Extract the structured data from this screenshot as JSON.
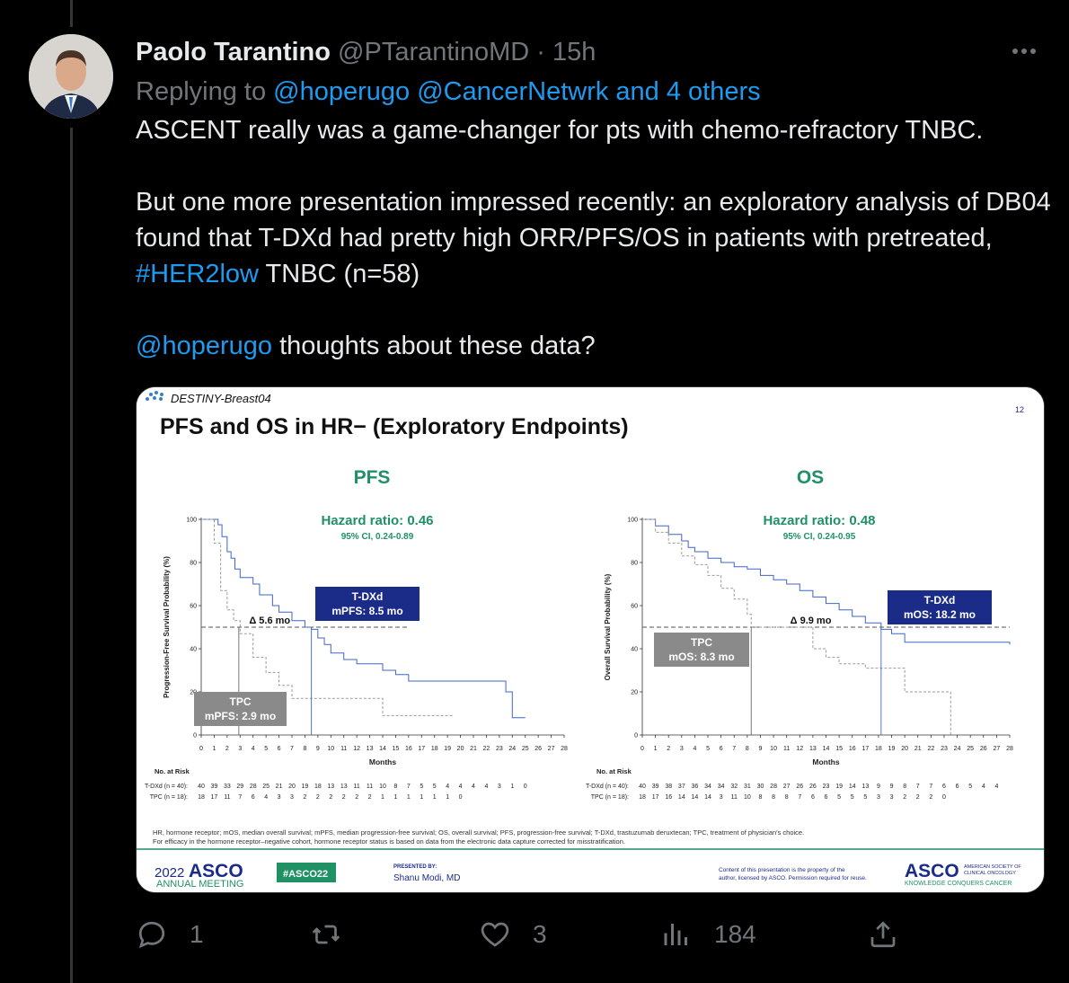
{
  "tweet": {
    "author_name": "Paolo Tarantino",
    "handle": "@PTarantinoMD",
    "separator": "·",
    "time": "15h",
    "replying_prefix": "Replying to",
    "replying_to": "@hoperugo @CancerNetwrk and 4 others",
    "paragraph1": "ASCENT really was a game-changer for pts with chemo-refractory TNBC.",
    "paragraph2_pre": "But one more presentation impressed recently: an exploratory analysis of DB04 found that T-DXd had pretty high ORR/PFS/OS in patients with pretreated,",
    "paragraph2_hashtag": "#HER2low",
    "paragraph2_post": "TNBC (n=58)",
    "paragraph3_mention": "@hoperugo",
    "paragraph3_post": "thoughts about these data?"
  },
  "actions": {
    "replies": "1",
    "retweets": "",
    "likes": "3",
    "views": "184"
  },
  "slide": {
    "study": "DESTINY-Breast04",
    "page": "12",
    "title": "PFS and OS in HR− (Exploratory Endpoints)",
    "footnote1": "HR, hormone receptor; mOS, median overall survival; mPFS, median progression-free survival; OS, overall survival; PFS, progression-free survival; T-DXd, trastuzumab deruxtecan; TPC, treatment of physician's choice.",
    "footnote2": "For efficacy in the hormone receptor–negative cohort, hormone receptor status is based on data from the electronic data capture corrected for misstratification.",
    "footer": {
      "meeting_year": "2022",
      "meeting_name": "ASCO",
      "meeting_sub": "ANNUAL MEETING",
      "hashtag": "#ASCO22",
      "presented_by": "PRESENTED BY:",
      "presenter": "Shanu Modi, MD",
      "copyright1": "Content of this presentation is the property of the",
      "copyright2": "author, licensed by ASCO. Permission required for reuse.",
      "asco": "ASCO",
      "asco_sub1": "AMERICAN SOCIETY OF",
      "asco_sub2": "CLINICAL ONCOLOGY",
      "tagline": "KNOWLEDGE CONQUERS CANCER"
    }
  },
  "colors": {
    "green": "#1f9165",
    "navy": "#1b2b88",
    "tdxd_line": "#3f66c6",
    "tpc_line": "#9a9a9a",
    "tpc_box": "#8a8a8a"
  },
  "chart_data": [
    {
      "type": "line",
      "title": "PFS",
      "hr_text": "Hazard ratio: 0.46",
      "ci_text": "95% CI, 0.24-0.89",
      "xlabel": "Months",
      "ylabel": "Progression-Free Survival Probability (%)",
      "xlim": [
        0,
        28
      ],
      "ylim": [
        0,
        100
      ],
      "xticks": [
        0,
        1,
        2,
        3,
        4,
        5,
        6,
        7,
        8,
        9,
        10,
        11,
        12,
        13,
        14,
        15,
        16,
        17,
        18,
        19,
        20,
        21,
        22,
        23,
        24,
        25,
        26,
        27,
        28
      ],
      "yticks": [
        0,
        20,
        40,
        60,
        80,
        100
      ],
      "delta_label": "Δ 5.6 mo",
      "tdxd_box": [
        "T-DXd",
        "mPFS: 8.5 mo"
      ],
      "tpc_box": [
        "TPC",
        "mPFS: 2.9 mo"
      ],
      "series": [
        {
          "name": "T-DXd",
          "x": [
            0,
            1,
            1.3,
            1.6,
            2,
            2.3,
            2.6,
            3,
            3.5,
            4,
            4.5,
            5.5,
            6,
            7,
            8,
            8.5,
            9,
            9.5,
            10,
            11,
            12,
            13,
            14,
            15,
            16,
            17,
            18,
            19,
            20,
            21,
            22,
            23,
            23.5,
            24,
            25
          ],
          "y": [
            100,
            100,
            97.5,
            92,
            85,
            82,
            77,
            73,
            73,
            70,
            65,
            60,
            57,
            53,
            50,
            49,
            45,
            42,
            38,
            35,
            33,
            33,
            30,
            28,
            25,
            25,
            25,
            25,
            25,
            25,
            25,
            25,
            20,
            8,
            8
          ]
        },
        {
          "name": "TPC",
          "x": [
            0,
            1,
            1.5,
            2,
            2.5,
            3,
            4,
            5,
            6,
            7,
            8,
            9,
            10,
            12,
            14,
            16,
            18,
            19.5
          ],
          "y": [
            100,
            89,
            67,
            58,
            53,
            47,
            36,
            29,
            23,
            17,
            17,
            17,
            17,
            17,
            9,
            9,
            9,
            9
          ]
        }
      ],
      "risk_table": {
        "header": "No. at Risk",
        "rows": [
          {
            "label": "T-DXd (n = 40):",
            "values": [
              "40",
              "39",
              "33",
              "29",
              "28",
              "25",
              "21",
              "20",
              "19",
              "18",
              "13",
              "13",
              "11",
              "11",
              "10",
              "8",
              "7",
              "5",
              "5",
              "4",
              "4",
              "4",
              "4",
              "3",
              "1",
              "0"
            ]
          },
          {
            "label": "TPC (n = 18):",
            "values": [
              "18",
              "17",
              "11",
              "7",
              "6",
              "4",
              "3",
              "3",
              "2",
              "2",
              "2",
              "2",
              "2",
              "2",
              "1",
              "1",
              "1",
              "1",
              "1",
              "1",
              "0"
            ]
          }
        ]
      }
    },
    {
      "type": "line",
      "title": "OS",
      "hr_text": "Hazard ratio: 0.48",
      "ci_text": "95% CI, 0.24-0.95",
      "xlabel": "Months",
      "ylabel": "Overall Survival Probability (%)",
      "xlim": [
        0,
        28
      ],
      "ylim": [
        0,
        100
      ],
      "xticks": [
        0,
        1,
        2,
        3,
        4,
        5,
        6,
        7,
        8,
        9,
        10,
        11,
        12,
        13,
        14,
        15,
        16,
        17,
        18,
        19,
        20,
        21,
        22,
        23,
        24,
        25,
        26,
        27,
        28
      ],
      "yticks": [
        0,
        20,
        40,
        60,
        80,
        100
      ],
      "delta_label": "Δ 9.9 mo",
      "tdxd_box": [
        "T-DXd",
        "mOS: 18.2 mo"
      ],
      "tpc_box": [
        "TPC",
        "mOS: 8.3 mo"
      ],
      "series": [
        {
          "name": "T-DXd",
          "x": [
            0,
            1,
            2,
            3,
            3.5,
            4,
            5,
            6,
            7,
            8,
            9,
            10,
            11,
            12,
            13,
            14,
            15,
            16,
            17,
            18,
            18.2,
            19,
            20,
            21,
            22,
            23,
            24,
            25,
            26,
            27,
            28
          ],
          "y": [
            100,
            97,
            93,
            90,
            87,
            85,
            82,
            80,
            78,
            77,
            74,
            72,
            70,
            67,
            64,
            61,
            58,
            55,
            52,
            52,
            49,
            47,
            43,
            43,
            43,
            43,
            43,
            43,
            43,
            43,
            42
          ]
        },
        {
          "name": "TPC",
          "x": [
            0,
            1,
            2,
            3,
            4,
            5,
            6,
            7,
            8,
            8.3,
            9,
            10,
            11,
            12,
            13,
            14,
            15,
            16,
            17,
            18,
            19,
            20,
            21,
            22,
            23,
            23.5
          ],
          "y": [
            100,
            94,
            89,
            83,
            79,
            74,
            68,
            63,
            56,
            50,
            50,
            50,
            50,
            50,
            40,
            36,
            33,
            33,
            31,
            31,
            31,
            20,
            20,
            20,
            20,
            0
          ]
        }
      ],
      "risk_table": {
        "header": "No. at Risk",
        "rows": [
          {
            "label": "T-DXd (n = 40):",
            "values": [
              "40",
              "39",
              "38",
              "37",
              "36",
              "34",
              "34",
              "32",
              "31",
              "30",
              "28",
              "27",
              "26",
              "26",
              "23",
              "19",
              "14",
              "13",
              "9",
              "9",
              "8",
              "7",
              "7",
              "6",
              "6",
              "5",
              "4",
              "4"
            ]
          },
          {
            "label": "TPC (n = 18):",
            "values": [
              "18",
              "17",
              "16",
              "14",
              "14",
              "14",
              "3",
              "11",
              "10",
              "8",
              "8",
              "8",
              "7",
              "6",
              "6",
              "5",
              "5",
              "5",
              "3",
              "3",
              "2",
              "2",
              "2",
              "0"
            ]
          }
        ]
      }
    }
  ]
}
